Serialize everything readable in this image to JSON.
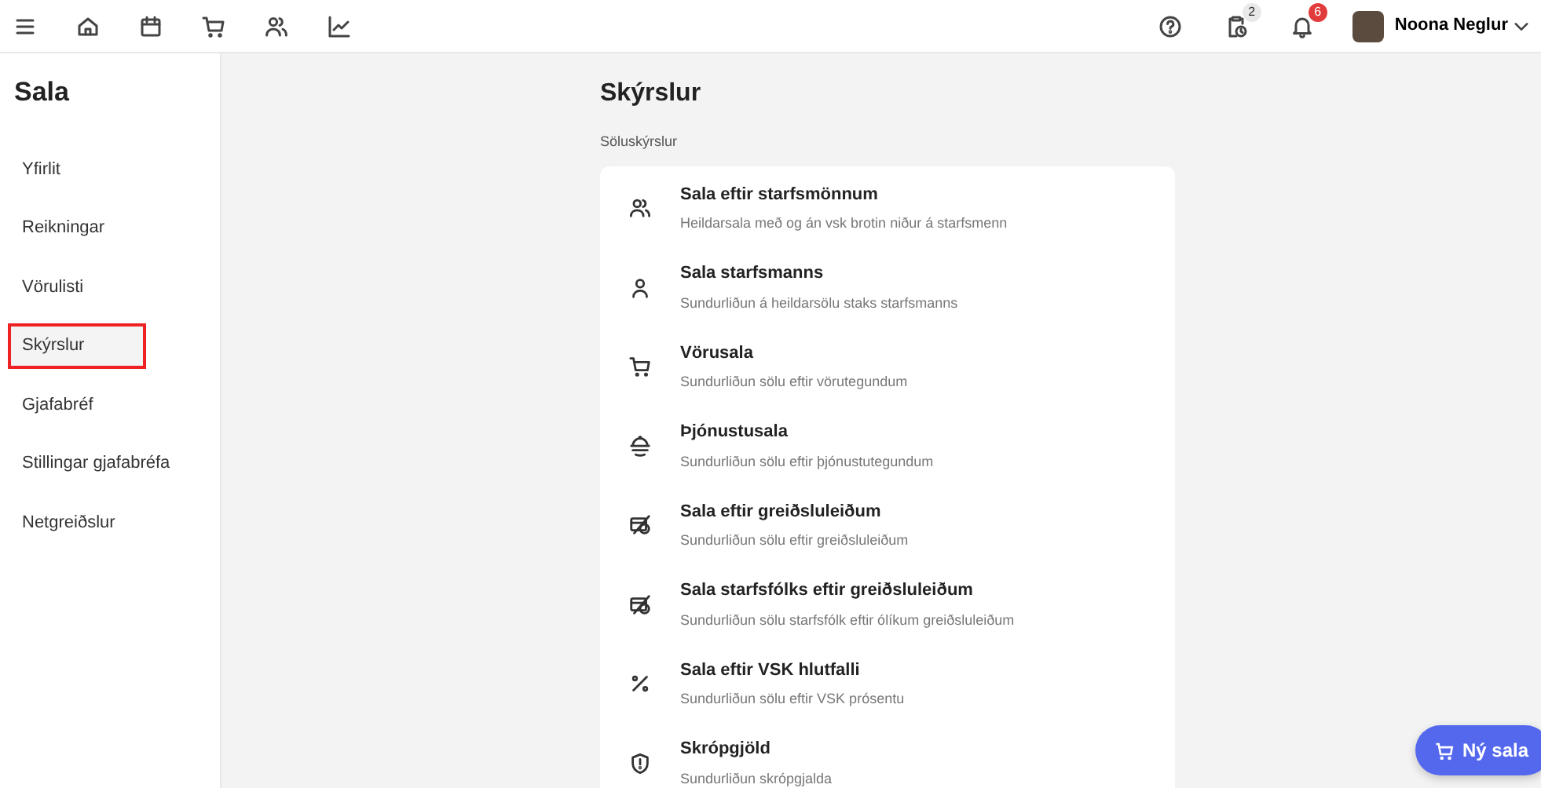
{
  "topbar": {
    "badges": [
      {
        "count": "2"
      },
      {
        "count": "6"
      }
    ],
    "user": {
      "name": "Noona Neglur"
    }
  },
  "sidebar": {
    "title": "Sala",
    "items": [
      {
        "label": "Yfirlit",
        "selected": false
      },
      {
        "label": "Reikningar",
        "selected": false
      },
      {
        "label": "Vörulisti",
        "selected": false
      },
      {
        "label": "Skýrslur",
        "selected": true
      },
      {
        "label": "Gjafabréf",
        "selected": false
      },
      {
        "label": "Stillingar gjafabréfa",
        "selected": false
      },
      {
        "label": "Netgreiðslur",
        "selected": false
      }
    ]
  },
  "page": {
    "title": "Skýrslur",
    "section": "Söluskýrslur"
  },
  "reports": [
    {
      "kind": "staff",
      "title": "Sala eftir starfsmönnum",
      "description": "Heildarsala með og án vsk brotin niður á starfsmenn"
    },
    {
      "kind": "person",
      "title": "Sala starfsmanns",
      "description": "Sundurliðun á heildarsölu staks starfsmanns"
    },
    {
      "kind": "cart",
      "title": "Vörusala",
      "description": "Sundurliðun sölu eftir vörutegundum"
    },
    {
      "kind": "service",
      "title": "Þjónustusala",
      "description": "Sundurliðun sölu eftir þjónustutegundum"
    },
    {
      "kind": "payment",
      "title": "Sala eftir greiðsluleiðum",
      "description": "Sundurliðun sölu eftir greiðsluleiðum"
    },
    {
      "kind": "payment",
      "title": "Sala starfsfólks eftir greiðsluleiðum",
      "description": "Sundurliðun sölu starfsfólk eftir ólíkum greiðsluleiðum"
    },
    {
      "kind": "percent",
      "title": "Sala eftir VSK hlutfalli",
      "description": "Sundurliðun sölu eftir VSK prósentu"
    },
    {
      "kind": "shield",
      "title": "Skrópgjöld",
      "description": "Sundurliðun skrópgjalda"
    }
  ],
  "fab": {
    "label": "Ný sala"
  }
}
